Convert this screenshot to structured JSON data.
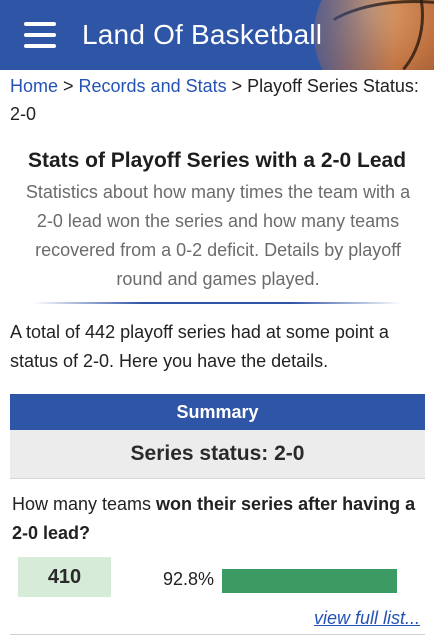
{
  "header": {
    "title": "Land Of Basketball",
    "menu_icon": "hamburger-menu-icon",
    "brand_color": "#2f55a6"
  },
  "breadcrumb": {
    "home": "Home",
    "sep1": " > ",
    "records": "Records and Stats",
    "sep2": " > ",
    "current": "Playoff Series Status: 2-0"
  },
  "page": {
    "title": "Stats of Playoff Series with a 2-0 Lead",
    "description": "Statistics about how many times the team with a 2-0 lead won the series and how many teams recovered from a 0-2 deficit. Details by playoff round and games played.",
    "intro": "A total of 442 playoff series had at some point a status of 2-0. Here you have the details."
  },
  "summary": {
    "header": "Summary",
    "status": "Series status: 2-0",
    "question_prefix": "How many teams ",
    "question_bold": "won their series after having a 2-0 lead?",
    "count": "410",
    "percent_label": "92.8%",
    "percent_value": 92.8,
    "bar_color": "#3c9a63",
    "count_bg": "#d7ecd8",
    "view_link": "view full list..."
  }
}
